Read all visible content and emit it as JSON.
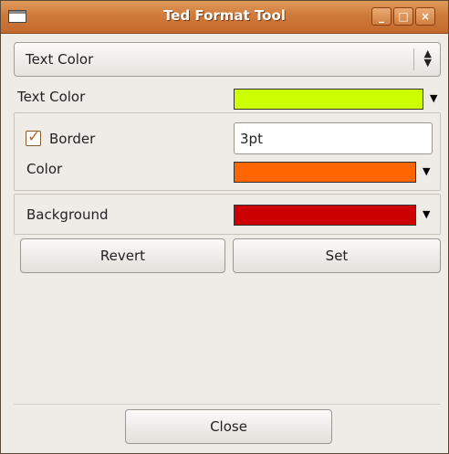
{
  "window": {
    "title": "Ted Format Tool",
    "buttons": {
      "minimize": "_",
      "maximize": "□",
      "close": "×"
    }
  },
  "selector": {
    "value": "Text Color",
    "arrows_icon": "up-down-arrows-icon"
  },
  "text_color": {
    "label": "Text Color",
    "color": "#ccff00"
  },
  "border": {
    "checkbox_label": "Border",
    "checked": true,
    "checkmark": "✓",
    "width_value": "3pt",
    "color_label": "Color",
    "color": "#ff6600"
  },
  "background": {
    "label": "Background",
    "color": "#cc0000"
  },
  "dropdown_arrow": "▼",
  "actions": {
    "revert": "Revert",
    "set": "Set",
    "close": "Close"
  },
  "colors": {
    "titlebar": "#cf7a3a",
    "window_bg": "#efebe7",
    "accent": "#c8602a"
  }
}
